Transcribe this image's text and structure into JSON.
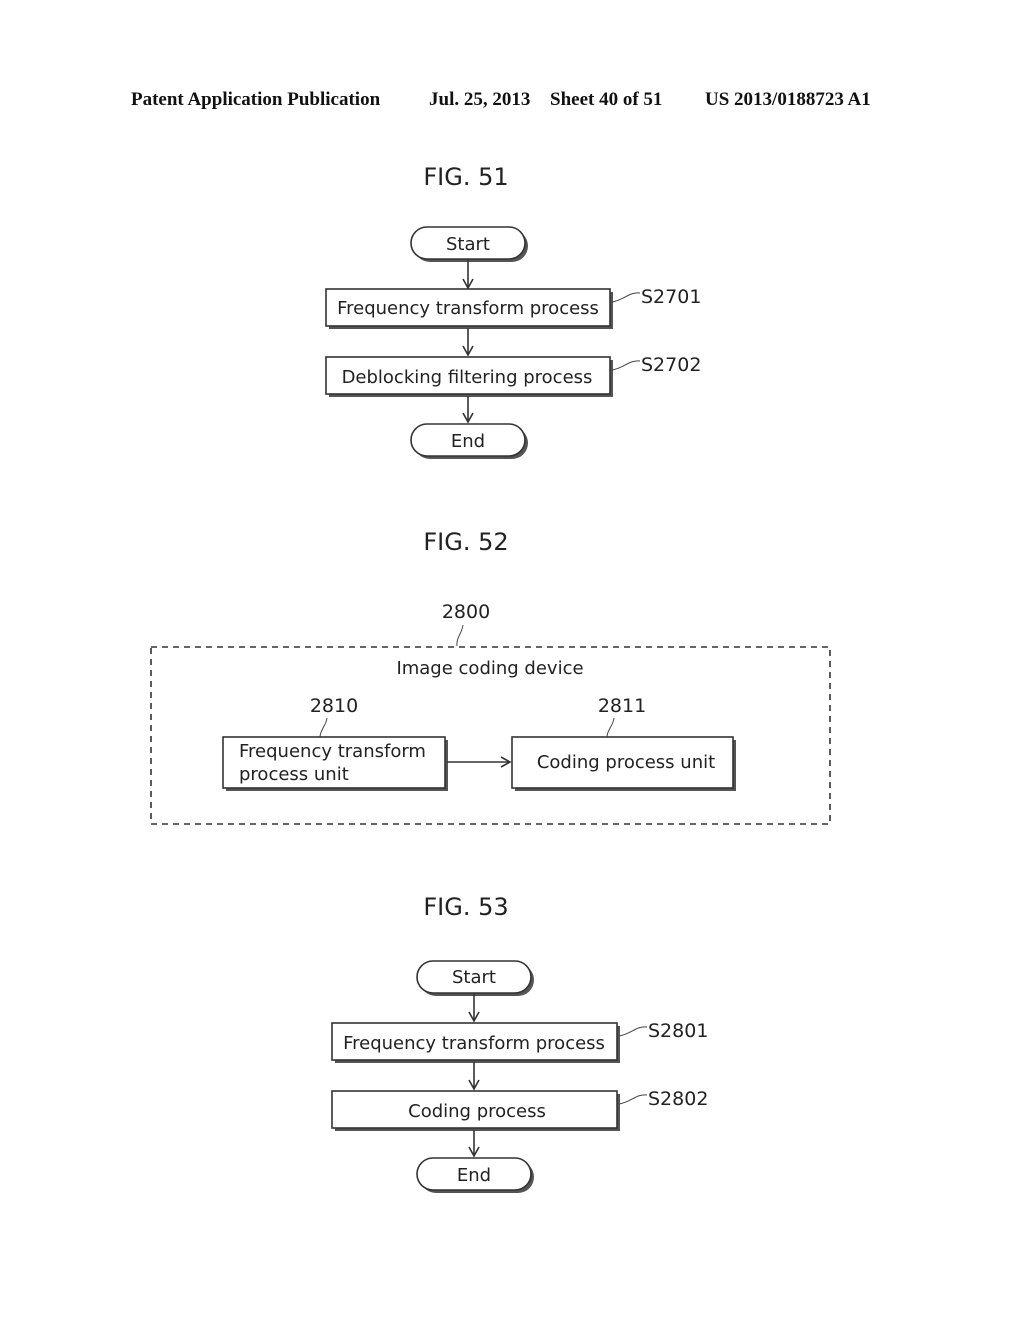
{
  "header": {
    "publication": "Patent Application Publication",
    "date": "Jul. 25, 2013",
    "sheet": "Sheet 40 of 51",
    "number": "US 2013/0188723 A1"
  },
  "fig51": {
    "title": "FIG. 51",
    "start": "Start",
    "steps": [
      {
        "label": "Frequency transform process",
        "ref": "S2701"
      },
      {
        "label": "Deblocking filtering process",
        "ref": "S2702"
      }
    ],
    "end": "End"
  },
  "fig52": {
    "title": "FIG. 52",
    "device_ref": "2800",
    "device_label": "Image coding device",
    "units": [
      {
        "ref": "2810",
        "line1": "Frequency transform",
        "line2": "process unit"
      },
      {
        "ref": "2811",
        "line1": "Coding process unit"
      }
    ]
  },
  "fig53": {
    "title": "FIG. 53",
    "start": "Start",
    "steps": [
      {
        "label": "Frequency transform process",
        "ref": "S2801"
      },
      {
        "label": "Coding process",
        "ref": "S2802"
      }
    ],
    "end": "End"
  }
}
